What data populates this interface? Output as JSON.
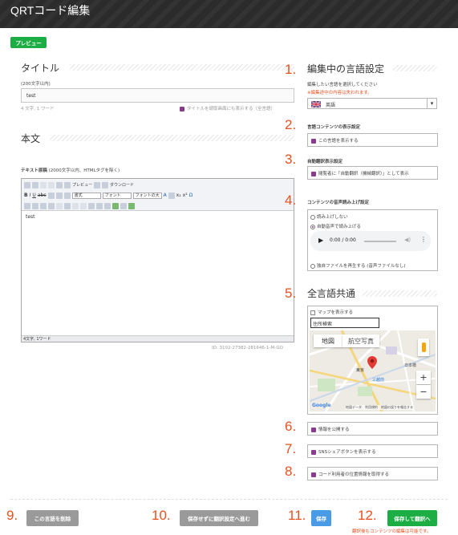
{
  "header": {
    "title": "QRTコード編集"
  },
  "preview_button": "プレビュー",
  "title_section": {
    "heading": "タイトル",
    "hint": "(200文字以内)",
    "value": "test",
    "count": "4 文字, 1 ワード",
    "show_on_reader": "タイトルを読取画面にも表示する（全言語）"
  },
  "body_section": {
    "heading": "本文",
    "label": "テキスト原稿",
    "hint": "(2000文字以内、HTMLタグを除く)",
    "toolbar": {
      "preview": "プレビュー",
      "download": "ダウンロード",
      "format": "書式",
      "font": "フォント",
      "font_size": "フォントの大"
    },
    "content": "test",
    "status": "4文字, 1ワード",
    "id": "ID: 3102-27382-281646-1-M-GO"
  },
  "language_section": {
    "num": "1.",
    "heading": "編集中の言語設定",
    "hint": "編集したい言語を選択してください",
    "warning": "※編集途中の内容は失われます。",
    "selected": "英語",
    "warning_color": "#e8501e"
  },
  "display_section": {
    "num": "2.",
    "heading": "言語コンテンツの表示設定",
    "option": "この言語を表示する"
  },
  "auto_translate": {
    "num": "3.",
    "heading": "自動翻訳表示設定",
    "option": "閲覧者に「自動翻訳（機械翻訳）」として表示"
  },
  "audio_section": {
    "num": "4.",
    "heading": "コンテンツの音声読み上げ設定",
    "opt1": "読み上げしない",
    "opt2": "自動音声で読み上げる",
    "time": "0:00 / 0:00",
    "opt3": "独自ファイルを再生する (音声ファイルなし)"
  },
  "common_section": {
    "num": "5.",
    "heading": "全言語共通",
    "show_map": "マップを表示する",
    "address_placeholder": "住所検索",
    "map_tab1": "地図",
    "map_tab2": "航空写真",
    "map_label1": "日本橋",
    "map_label2": "三越前",
    "map_label3": "東京",
    "map_footer": "地図データ　利用規約　地図の誤りを報告する",
    "google": "Google"
  },
  "publish": {
    "num": "6.",
    "label": "情報を公開する"
  },
  "sns": {
    "num": "7.",
    "label": "SNSシェアボタンを表示する"
  },
  "location": {
    "num": "8.",
    "label": "コード利用者の位置情報を取得する"
  },
  "footer": {
    "num9": "9.",
    "delete": "この言語を削除",
    "num10": "10.",
    "skip": "保存せずに翻訳設定へ進む",
    "num11": "11.",
    "save": "保存",
    "num12": "12.",
    "save_translate": "保存して翻訳へ",
    "note": "翻訳後もコンテンツの編集は可能です。"
  }
}
